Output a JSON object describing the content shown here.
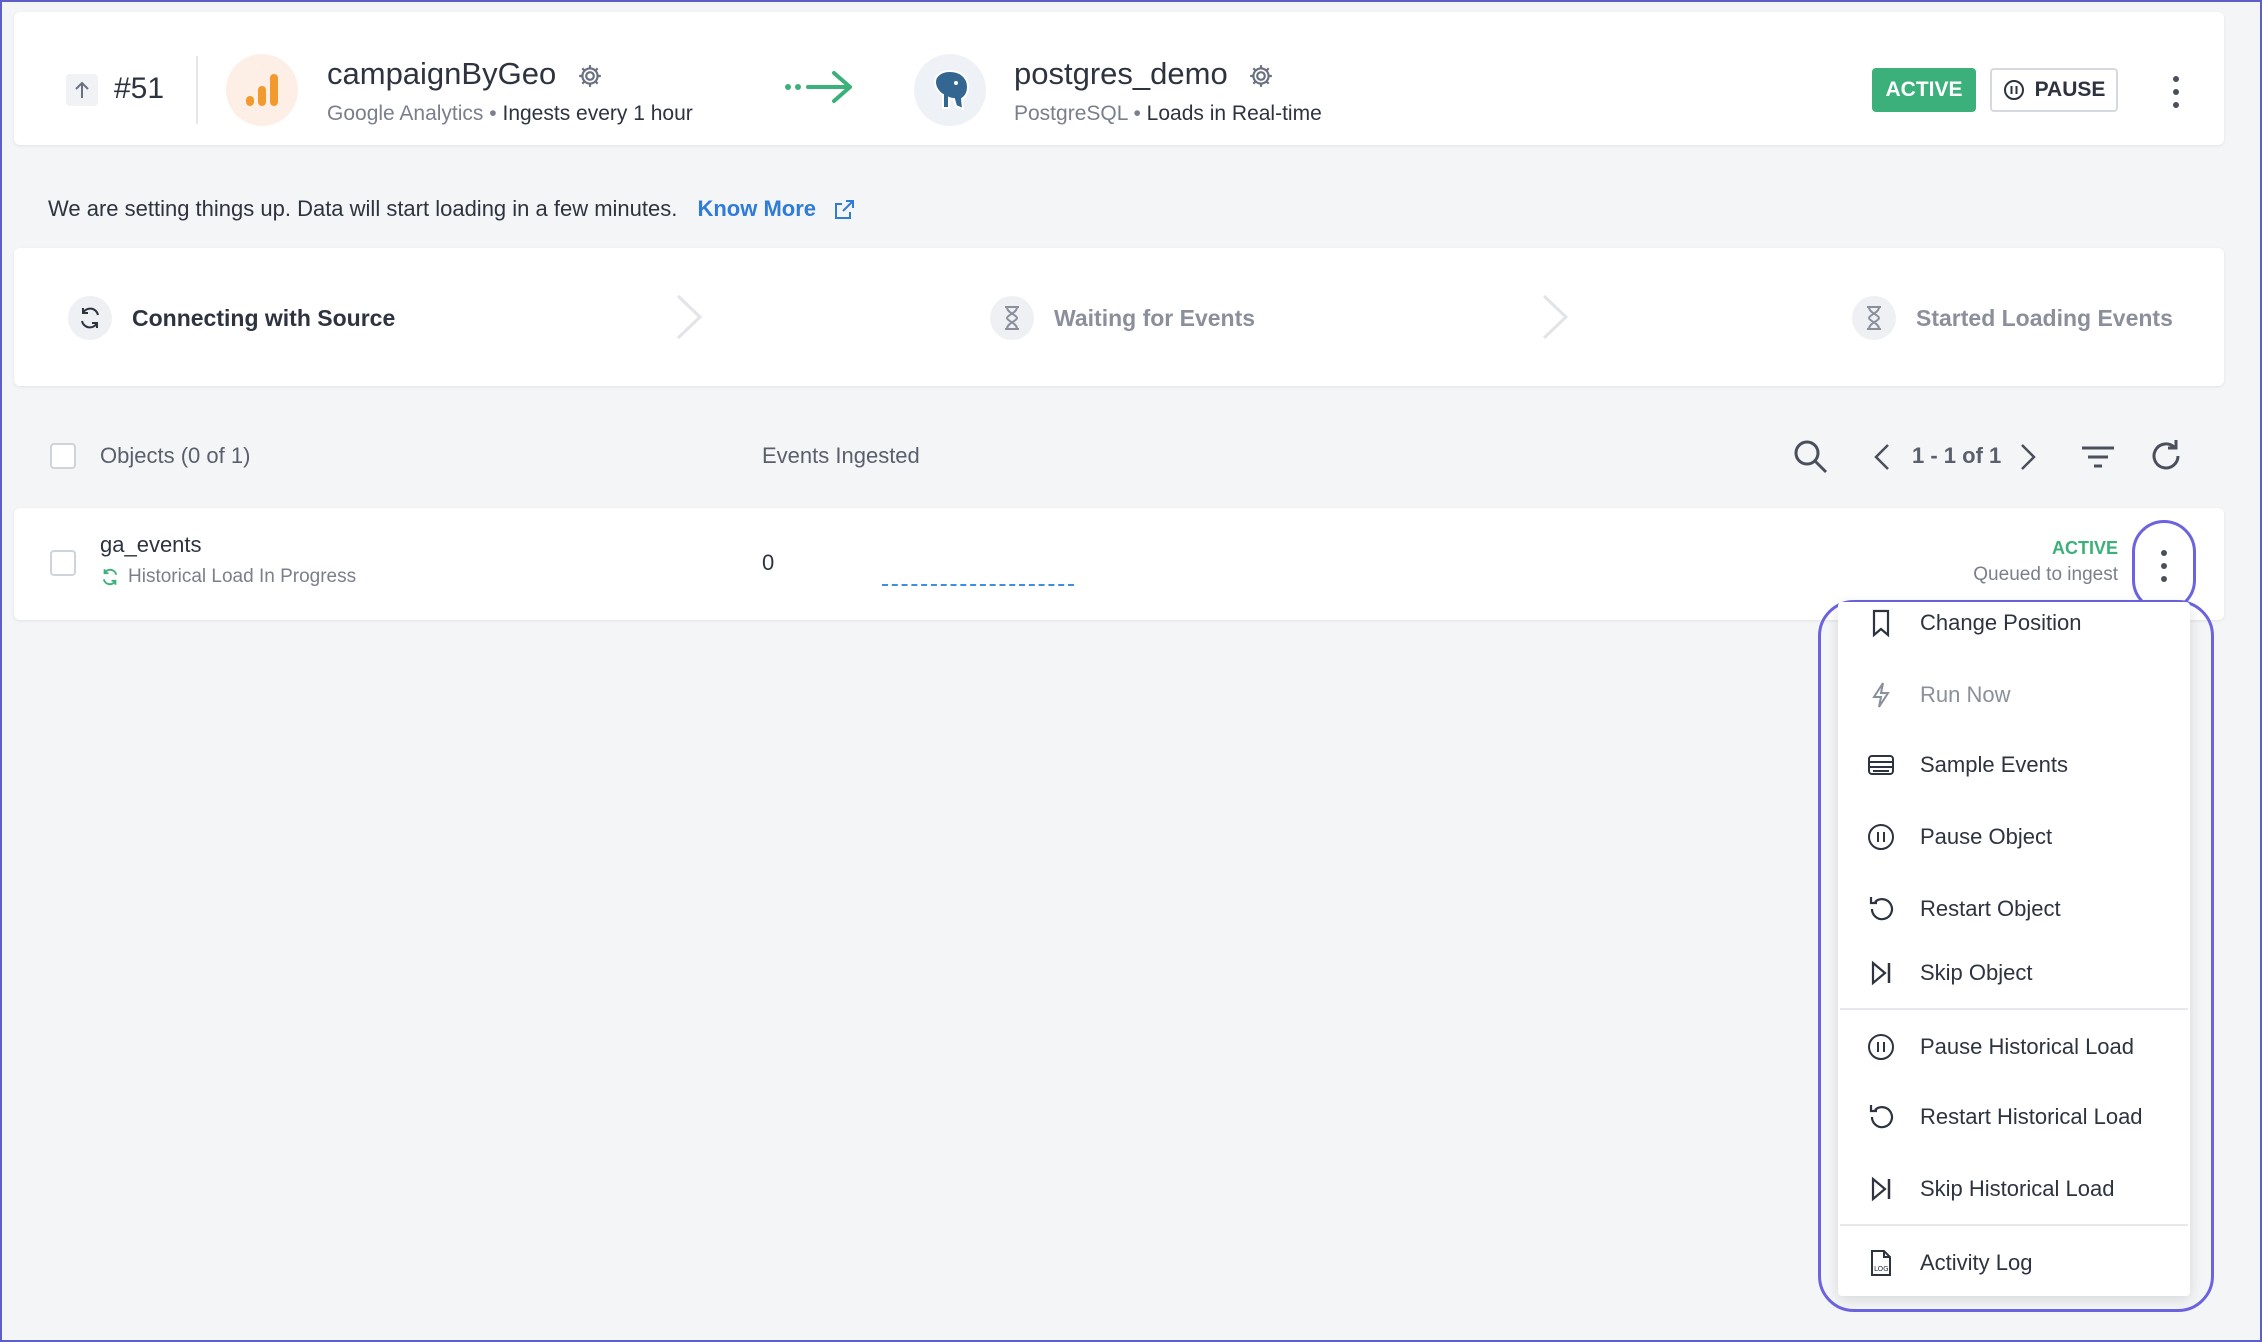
{
  "header": {
    "pipeline_number": "#51",
    "source": {
      "name": "campaignByGeo",
      "type": "Google Analytics",
      "schedule": "Ingests every 1 hour"
    },
    "destination": {
      "name": "postgres_demo",
      "type": "PostgreSQL",
      "mode": "Loads in Real-time"
    },
    "status_badge": "ACTIVE",
    "pause_label": "PAUSE",
    "separator": "•"
  },
  "info": {
    "message": "We are setting things up. Data will start loading in a few minutes.",
    "link": "Know More"
  },
  "steps": [
    {
      "label": "Connecting with Source",
      "state": "current",
      "icon": "sync-icon"
    },
    {
      "label": "Waiting for Events",
      "state": "pending",
      "icon": "hourglass-icon"
    },
    {
      "label": "Started Loading Events",
      "state": "pending",
      "icon": "hourglass-icon"
    }
  ],
  "table": {
    "objects_header": "Objects (0 of 1)",
    "events_header": "Events Ingested",
    "pagination": "1 - 1 of 1",
    "rows": [
      {
        "name": "ga_events",
        "sub_status": "Historical Load In Progress",
        "events": "0",
        "status": "ACTIVE",
        "status_detail": "Queued to ingest"
      }
    ]
  },
  "menu": {
    "items": [
      {
        "label": "Change Position",
        "icon": "bookmark-icon"
      },
      {
        "label": "Run Now",
        "icon": "lightning-icon",
        "disabled": true
      },
      {
        "label": "Sample Events",
        "icon": "stack-icon"
      },
      {
        "label": "Pause Object",
        "icon": "pause-circle-icon"
      },
      {
        "label": "Restart Object",
        "icon": "restart-icon"
      },
      {
        "label": "Skip Object",
        "icon": "skip-icon"
      },
      {
        "label": "Pause Historical Load",
        "icon": "pause-circle-icon"
      },
      {
        "label": "Restart Historical Load",
        "icon": "restart-icon"
      },
      {
        "label": "Skip Historical Load",
        "icon": "skip-icon"
      },
      {
        "label": "Activity Log",
        "icon": "log-file-icon"
      }
    ]
  },
  "colors": {
    "accent_green": "#3bb07a",
    "link_blue": "#2f7bd8",
    "highlight_purple": "#6c63e0"
  }
}
